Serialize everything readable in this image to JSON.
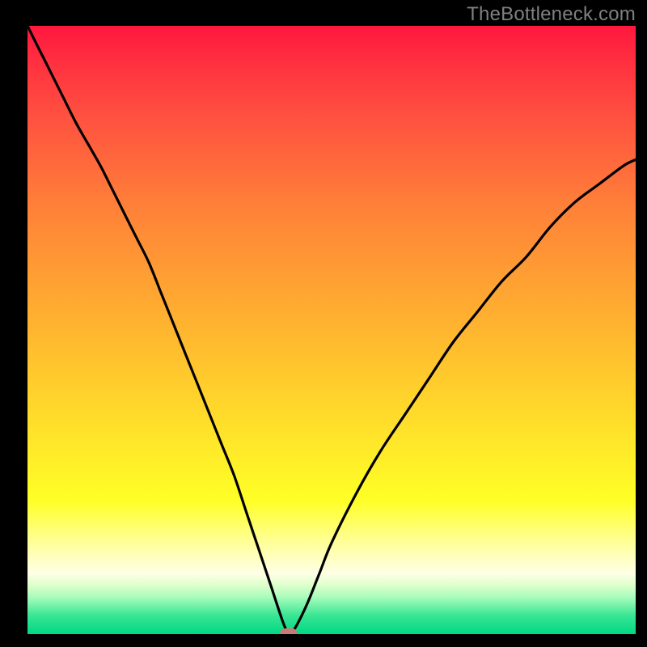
{
  "watermark": "TheBottleneck.com",
  "colors": {
    "page_bg": "#000000",
    "curve": "#000000",
    "marker": "#cb7a72"
  },
  "chart_data": {
    "type": "line",
    "title": "",
    "xlabel": "",
    "ylabel": "",
    "xlim": [
      0,
      100
    ],
    "ylim": [
      0,
      100
    ],
    "grid": false,
    "x": [
      0,
      2,
      4,
      6,
      8,
      10,
      12,
      14,
      16,
      18,
      20,
      22,
      24,
      26,
      28,
      30,
      32,
      34,
      36,
      38,
      40,
      42,
      43,
      44,
      46,
      48,
      50,
      54,
      58,
      62,
      66,
      70,
      74,
      78,
      82,
      86,
      90,
      94,
      98,
      100
    ],
    "values": [
      100,
      96,
      92,
      88,
      84,
      80.5,
      77,
      73,
      69,
      65,
      61,
      56,
      51,
      46,
      41,
      36,
      31,
      26,
      20,
      14,
      8,
      2,
      0,
      1,
      5,
      10,
      15,
      23,
      30,
      36,
      42,
      48,
      53,
      58,
      62,
      67,
      71,
      74,
      77,
      78
    ],
    "marker": {
      "x": 43,
      "y": 0
    },
    "note": "No axis ticks or numeric labels are visible; x and y are normalised 0-100 across the plot area. Values estimated from curve pixel positions at 800×800."
  }
}
